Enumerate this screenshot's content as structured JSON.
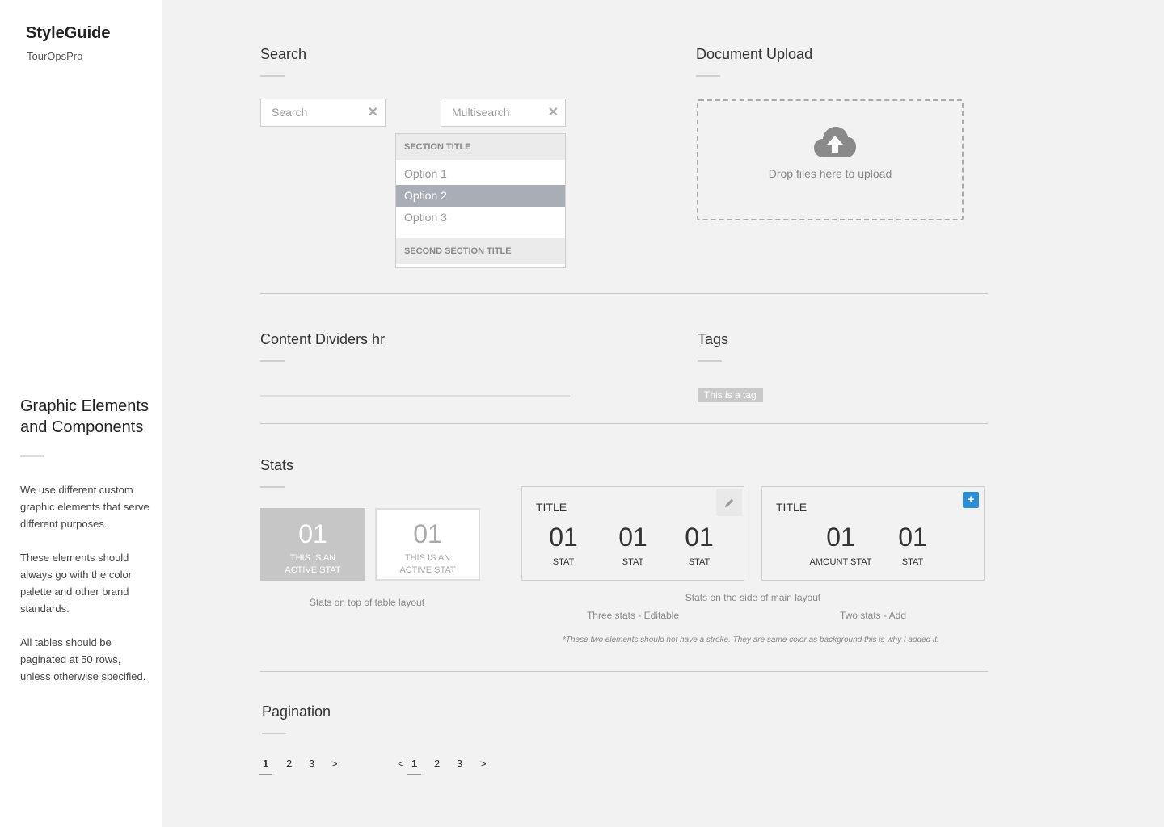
{
  "sidebar": {
    "brand": "StyleGuide",
    "subtitle": "TourOpsPro",
    "heading": "Graphic Elements and Components",
    "paragraphs": [
      "We use different custom graphic elements that serve different purposes.",
      "These elements should always go with the color palette and other brand standards.",
      "All tables should be paginated at 50 rows, unless otherwise specified."
    ]
  },
  "search": {
    "title": "Search",
    "search_placeholder": "Search",
    "multisearch_placeholder": "Multisearch",
    "clear_glyph": "✕",
    "dropdown": {
      "section1": "SECTION TITLE",
      "options": [
        "Option 1",
        "Option 2",
        "Option 3"
      ],
      "selected_index": 1,
      "section2": "SECOND SECTION TITLE"
    }
  },
  "upload": {
    "title": "Document Upload",
    "text": "Drop files here to upload",
    "icon": "cloud-upload-icon"
  },
  "dividers": {
    "title": "Content Dividers hr"
  },
  "tags": {
    "title": "Tags",
    "tag_label": "This is a tag"
  },
  "stats": {
    "title": "Stats",
    "tile_active": {
      "value": "01",
      "label_line1": "THIS IS AN",
      "label_line2": "ACTIVE STAT"
    },
    "tile_inactive": {
      "value": "01",
      "label_line1": "THIS IS AN",
      "label_line2": "ACTIVE STAT"
    },
    "caption_table": "Stats on top of table layout",
    "caption_side": "Stats on the side of main layout",
    "card_editable": {
      "title": "TITLE",
      "stats": [
        {
          "value": "01",
          "label": "STAT"
        },
        {
          "value": "01",
          "label": "STAT"
        },
        {
          "value": "01",
          "label": "STAT"
        }
      ],
      "caption": "Three stats - Editable"
    },
    "card_add": {
      "title": "TITLE",
      "add_glyph": "+",
      "stats": [
        {
          "value": "01",
          "label": "AMOUNT STAT"
        },
        {
          "value": "01",
          "label": "STAT"
        }
      ],
      "caption": "Two stats - Add"
    },
    "note": "*These two elements should not have a stroke. They are same color as background this is why I added it.",
    "accent_color": "#2a8fd6"
  },
  "pagination": {
    "title": "Pagination",
    "pager1": {
      "pages": [
        "1",
        "2",
        "3"
      ],
      "next": ">"
    },
    "pager2": {
      "prev": "<",
      "pages": [
        "1",
        "2",
        "3"
      ],
      "next": ">"
    }
  }
}
